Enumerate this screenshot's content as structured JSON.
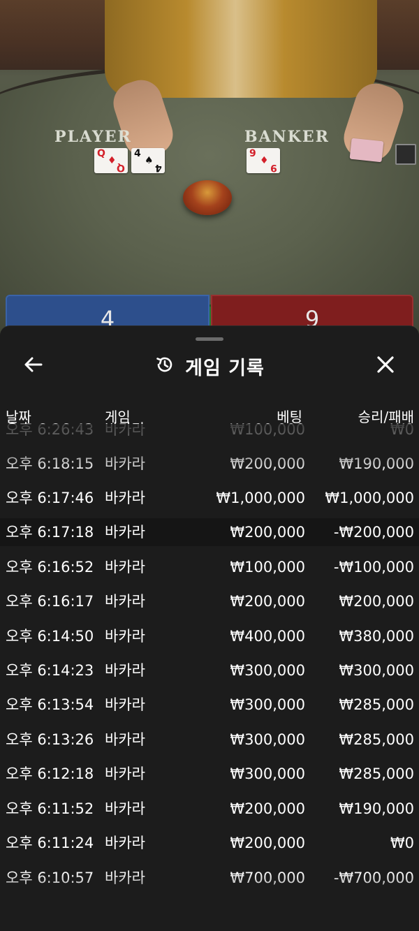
{
  "video": {
    "player_label": "PLAYER",
    "banker_label": "BANKER",
    "player_score": "4",
    "banker_score": "9",
    "player_cards": [
      {
        "rank": "Q",
        "suit": "♦",
        "color": "red"
      },
      {
        "rank": "4",
        "suit": "♠",
        "color": "black"
      }
    ],
    "banker_cards": [
      {
        "rank": "9",
        "suit": "♦",
        "color": "red"
      }
    ],
    "colors": {
      "player": "#2d4f8c",
      "banker": "#7f1e1e",
      "tie": "#267a33"
    }
  },
  "sheet": {
    "title": "게임 기록",
    "back_icon": "arrow-left-icon",
    "history_icon": "history-icon",
    "close_icon": "close-icon",
    "columns": {
      "date": "날짜",
      "game": "게임",
      "bet": "베팅",
      "result": "승리/패배"
    },
    "rows": [
      {
        "time": "오후 6:26:43",
        "game": "바카라",
        "bet": "₩100,000",
        "result": "₩0"
      },
      {
        "time": "오후 6:18:15",
        "game": "바카라",
        "bet": "₩200,000",
        "result": "₩190,000"
      },
      {
        "time": "오후 6:17:46",
        "game": "바카라",
        "bet": "₩1,000,000",
        "result": "₩1,000,000"
      },
      {
        "time": "오후 6:17:18",
        "game": "바카라",
        "bet": "₩200,000",
        "result": "-₩200,000"
      },
      {
        "time": "오후 6:16:52",
        "game": "바카라",
        "bet": "₩100,000",
        "result": "-₩100,000"
      },
      {
        "time": "오후 6:16:17",
        "game": "바카라",
        "bet": "₩200,000",
        "result": "₩200,000"
      },
      {
        "time": "오후 6:14:50",
        "game": "바카라",
        "bet": "₩400,000",
        "result": "₩380,000"
      },
      {
        "time": "오후 6:14:23",
        "game": "바카라",
        "bet": "₩300,000",
        "result": "₩300,000"
      },
      {
        "time": "오후 6:13:54",
        "game": "바카라",
        "bet": "₩300,000",
        "result": "₩285,000"
      },
      {
        "time": "오후 6:13:26",
        "game": "바카라",
        "bet": "₩300,000",
        "result": "₩285,000"
      },
      {
        "time": "오후 6:12:18",
        "game": "바카라",
        "bet": "₩300,000",
        "result": "₩285,000"
      },
      {
        "time": "오후 6:11:52",
        "game": "바카라",
        "bet": "₩200,000",
        "result": "₩190,000"
      },
      {
        "time": "오후 6:11:24",
        "game": "바카라",
        "bet": "₩200,000",
        "result": "₩0"
      },
      {
        "time": "오후 6:10:57",
        "game": "바카라",
        "bet": "₩700,000",
        "result": "-₩700,000"
      }
    ]
  }
}
